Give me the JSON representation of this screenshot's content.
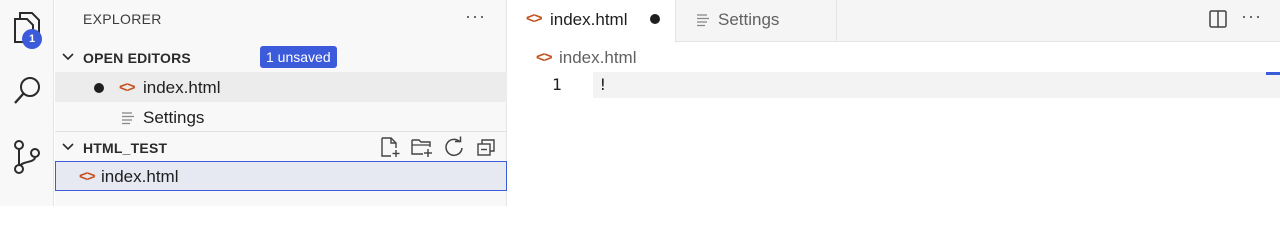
{
  "activity_bar": {
    "explorer_badge": "1",
    "icons": [
      "files-icon",
      "search-icon",
      "source-control-icon"
    ]
  },
  "sidebar": {
    "title": "EXPLORER",
    "more": "···",
    "open_editors": {
      "title": "OPEN EDITORS",
      "badge": "1 unsaved",
      "items": [
        {
          "label": "index.html",
          "icon": "html-file-icon",
          "dirty": true
        },
        {
          "label": "Settings",
          "icon": "settings-file-icon",
          "dirty": false
        }
      ]
    },
    "folder": {
      "title": "HTML_TEST",
      "actions": [
        "new-file-icon",
        "new-folder-icon",
        "refresh-icon",
        "collapse-all-icon"
      ],
      "items": [
        {
          "label": "index.html",
          "icon": "html-file-icon"
        }
      ]
    }
  },
  "editor": {
    "tabs": [
      {
        "label": "index.html",
        "active": true,
        "dirty": true
      },
      {
        "label": "Settings",
        "active": false,
        "dirty": false
      }
    ],
    "more": "···",
    "breadcrumb": "index.html",
    "lines": [
      {
        "number": "1",
        "text": "!"
      }
    ]
  },
  "colors": {
    "accent": "#3b5bdb",
    "html_icon": "#c5501a"
  }
}
